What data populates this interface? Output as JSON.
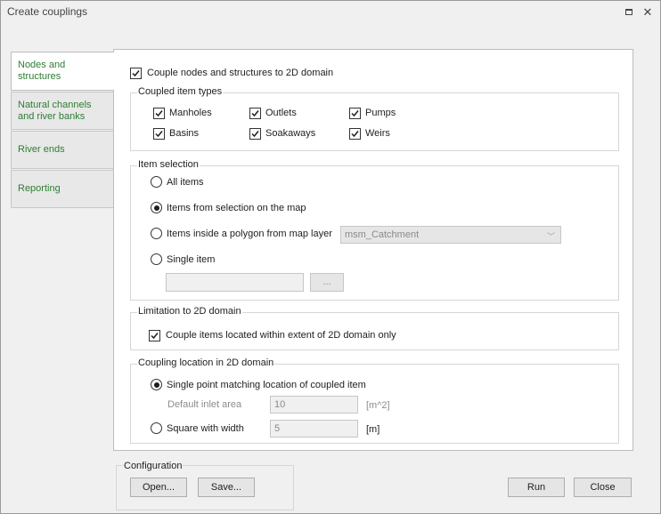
{
  "window": {
    "title": "Create couplings"
  },
  "tabs": [
    {
      "label": "Nodes and structures"
    },
    {
      "label": "Natural channels and river banks"
    },
    {
      "label": "River ends"
    },
    {
      "label": "Reporting"
    }
  ],
  "couple_nodes": {
    "label": "Couple nodes and structures to 2D domain",
    "checked": true
  },
  "coupled_item_types": {
    "title": "Coupled item types",
    "items": [
      {
        "label": "Manholes",
        "checked": true
      },
      {
        "label": "Outlets",
        "checked": true
      },
      {
        "label": "Pumps",
        "checked": true
      },
      {
        "label": "Basins",
        "checked": true
      },
      {
        "label": "Soakaways",
        "checked": true
      },
      {
        "label": "Weirs",
        "checked": true
      }
    ]
  },
  "item_selection": {
    "title": "Item selection",
    "options": [
      {
        "label": "All items",
        "selected": false
      },
      {
        "label": "Items from selection on the map",
        "selected": true
      },
      {
        "label": "Items inside a polygon from map layer",
        "selected": false
      },
      {
        "label": "Single item",
        "selected": false
      }
    ],
    "polygon_layer": "msm_Catchment",
    "single_item_value": "",
    "browse_label": "..."
  },
  "limitation": {
    "title": "Limitation to 2D domain",
    "label": "Couple items located within extent of 2D domain only",
    "checked": true
  },
  "coupling_location": {
    "title": "Coupling location in 2D domain",
    "single_point": {
      "label": "Single point matching location of coupled item",
      "selected": true
    },
    "inlet_area": {
      "label": "Default inlet area",
      "value": "10",
      "unit": "[m^2]"
    },
    "square": {
      "label": "Square with width",
      "selected": false,
      "value": "5",
      "unit": "[m]"
    }
  },
  "configuration": {
    "title": "Configuration",
    "open_label": "Open...",
    "save_label": "Save..."
  },
  "footer": {
    "run_label": "Run",
    "close_label": "Close"
  }
}
